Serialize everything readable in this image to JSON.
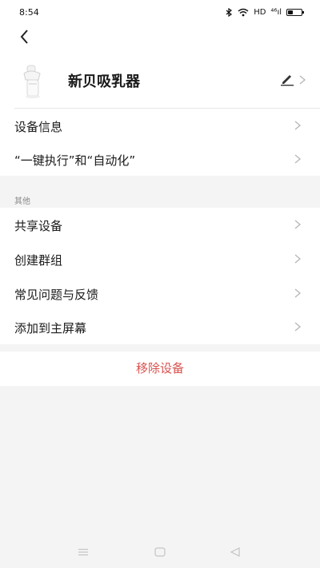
{
  "status": {
    "time": "8:54",
    "network": "HD",
    "signal": "⁴⁶ıl",
    "battery_level": 0.35
  },
  "header": {
    "device_name": "新贝吸乳器"
  },
  "main_items": [
    {
      "label": "设备信息"
    },
    {
      "label": "“一键执行”和“自动化”"
    }
  ],
  "other": {
    "section_title": "其他",
    "items": [
      {
        "label": "共享设备"
      },
      {
        "label": "创建群组"
      },
      {
        "label": "常见问题与反馈"
      },
      {
        "label": "添加到主屏幕"
      }
    ]
  },
  "remove": {
    "label": "移除设备"
  },
  "colors": {
    "remove_text": "#d9534f",
    "background": "#f4f4f4"
  },
  "icons": [
    "back-arrow-icon",
    "edit-icon",
    "chevron-right-icon",
    "menu-icon",
    "home-icon",
    "back-triangle-icon"
  ]
}
